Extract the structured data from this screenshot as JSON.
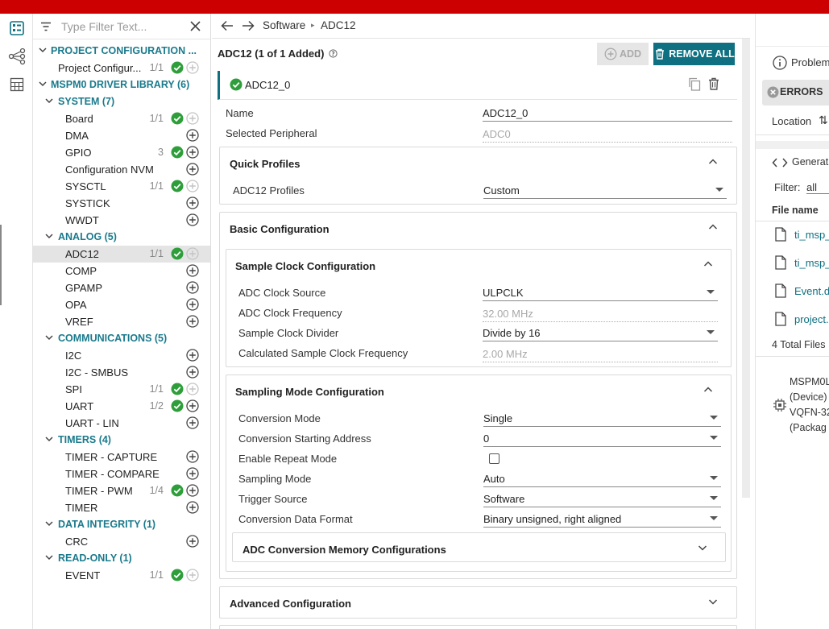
{
  "filter": {
    "placeholder": "Type Filter Text..."
  },
  "tree": {
    "rows": [
      {
        "label": "PROJECT CONFIGURATION ...",
        "kind": "top"
      },
      {
        "label": "Project Configur...",
        "count": "1/1",
        "status": "ok"
      },
      {
        "label": "MSPM0 DRIVER LIBRARY (6)",
        "kind": "top"
      },
      {
        "label": "SYSTEM (7)",
        "kind": "cat"
      },
      {
        "label": "Board",
        "count": "1/1",
        "status": "ok"
      },
      {
        "label": "DMA"
      },
      {
        "label": "GPIO",
        "count": "3",
        "status": "ok"
      },
      {
        "label": "Configuration NVM"
      },
      {
        "label": "SYSCTL",
        "count": "1/1",
        "status": "ok"
      },
      {
        "label": "SYSTICK"
      },
      {
        "label": "WWDT"
      },
      {
        "label": "ANALOG (5)",
        "kind": "cat"
      },
      {
        "label": "ADC12",
        "count": "1/1",
        "status": "ok",
        "selected": true
      },
      {
        "label": "COMP"
      },
      {
        "label": "GPAMP"
      },
      {
        "label": "OPA"
      },
      {
        "label": "VREF"
      },
      {
        "label": "COMMUNICATIONS (5)",
        "kind": "cat"
      },
      {
        "label": "I2C"
      },
      {
        "label": "I2C - SMBUS"
      },
      {
        "label": "SPI",
        "count": "1/1",
        "status": "ok"
      },
      {
        "label": "UART",
        "count": "1/2",
        "status": "ok",
        "addable": true
      },
      {
        "label": "UART - LIN"
      },
      {
        "label": "TIMERS (4)",
        "kind": "cat"
      },
      {
        "label": "TIMER - CAPTURE"
      },
      {
        "label": "TIMER - COMPARE"
      },
      {
        "label": "TIMER - PWM",
        "count": "1/4",
        "status": "ok",
        "addable": true
      },
      {
        "label": "TIMER"
      },
      {
        "label": "DATA INTEGRITY (1)",
        "kind": "cat"
      },
      {
        "label": "CRC"
      },
      {
        "label": "READ-ONLY (1)",
        "kind": "cat"
      },
      {
        "label": "EVENT",
        "count": "1/1",
        "status": "ok"
      }
    ]
  },
  "breadcrumb": {
    "root": "Software",
    "current": "ADC12"
  },
  "module": {
    "header": "ADC12 (1 of 1 Added)",
    "add_label": "ADD",
    "remove_label": "REMOVE ALL",
    "instance_name": "ADC12_0"
  },
  "props": {
    "name_label": "Name",
    "name_value": "ADC12_0",
    "peripheral_label": "Selected Peripheral",
    "peripheral_value": "ADC0"
  },
  "quick_profiles": {
    "title": "Quick Profiles",
    "profiles_label": "ADC12 Profiles",
    "profiles_value": "Custom"
  },
  "basic": {
    "title": "Basic Configuration"
  },
  "sample_clock": {
    "title": "Sample Clock Configuration",
    "source_label": "ADC Clock Source",
    "source_value": "ULPCLK",
    "freq_label": "ADC Clock Frequency",
    "freq_value": "32.00 MHz",
    "divider_label": "Sample Clock Divider",
    "divider_value": "Divide by 16",
    "calc_label": "Calculated Sample Clock Frequency",
    "calc_value": "2.00 MHz"
  },
  "sampling_mode": {
    "title": "Sampling Mode Configuration",
    "conv_mode_label": "Conversion Mode",
    "conv_mode_value": "Single",
    "start_addr_label": "Conversion Starting Address",
    "start_addr_value": "0",
    "repeat_label": "Enable Repeat Mode",
    "sampling_label": "Sampling Mode",
    "sampling_value": "Auto",
    "trigger_label": "Trigger Source",
    "trigger_value": "Software",
    "format_label": "Conversion Data Format",
    "format_value": "Binary unsigned, right aligned",
    "memory_title": "ADC Conversion Memory Configurations"
  },
  "advanced": {
    "title": "Advanced Configuration"
  },
  "right": {
    "problems_label": "Problem",
    "errors_label": "ERRORS",
    "location_label": "Location",
    "generated_label": "Generat",
    "filter_label": "Filter:",
    "filter_value": "all",
    "file_header": "File name",
    "files": [
      "ti_msp_",
      "ti_msp_",
      "Event.d",
      "project."
    ],
    "total": "4 Total Files",
    "device_lines": [
      "MSPM0L",
      "(Device)",
      "VQFN-32",
      "(Packag"
    ]
  },
  "colors": {
    "brand_red": "#cc0000",
    "accent": "#0e7080",
    "ok_green": "#2e9e3a"
  }
}
